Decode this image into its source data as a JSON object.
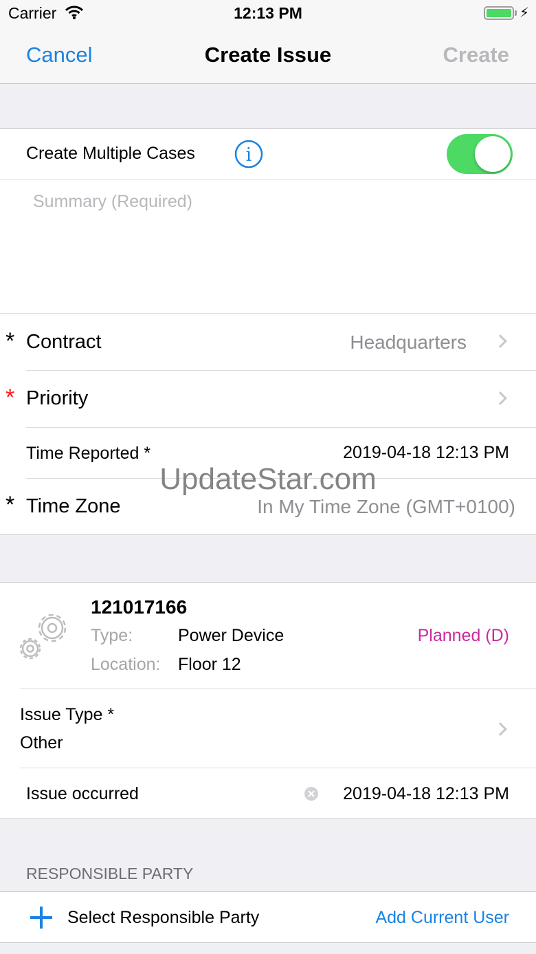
{
  "status_bar": {
    "carrier": "Carrier",
    "time": "12:13 PM"
  },
  "nav": {
    "cancel": "Cancel",
    "title": "Create Issue",
    "create": "Create"
  },
  "form": {
    "multiple_cases_label": "Create Multiple Cases",
    "multiple_cases_on": true,
    "summary_placeholder": "Summary (Required)",
    "contract_marker": "*",
    "contract_label": "Contract",
    "contract_value": "Headquarters",
    "priority_marker": "*",
    "priority_label": "Priority",
    "time_reported_label": "Time Reported *",
    "time_reported_value": "2019-04-18 12:13 PM",
    "timezone_marker": "*",
    "timezone_label": "Time Zone",
    "timezone_value": "In My Time Zone (GMT+0100)"
  },
  "asset": {
    "id": "121017166",
    "type_label": "Type:",
    "type_value": "Power Device",
    "status": "Planned (D)",
    "location_label": "Location:",
    "location_value": "Floor 12",
    "issue_type_label": "Issue Type *",
    "issue_type_value": "Other",
    "issue_occurred_label": "Issue occurred",
    "issue_occurred_value": "2019-04-18 12:13 PM"
  },
  "responsible": {
    "header": "RESPONSIBLE PARTY",
    "select_label": "Select Responsible Party",
    "add_current_user": "Add Current User"
  },
  "watermark": "UpdateStar.com",
  "colors": {
    "accent": "#1a82e2",
    "toggle_on": "#4cd964",
    "status_planned": "#cc2a9e",
    "required_red": "#ff1a1a"
  }
}
